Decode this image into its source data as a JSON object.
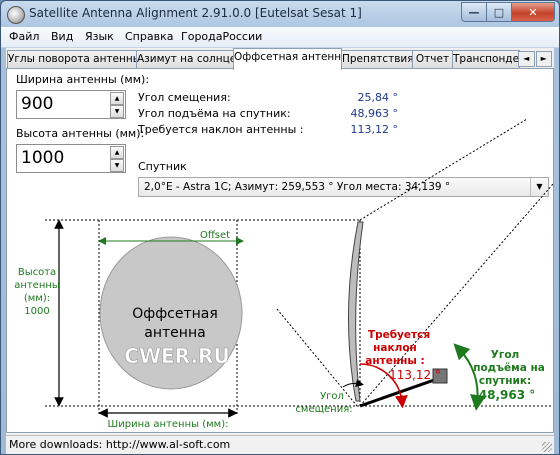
{
  "window": {
    "title": "Satellite Antenna Alignment 2.91.0.0 [Eutelsat Sesat 1]",
    "buttons": {
      "minimize": "—",
      "maximize": "□",
      "close": "✕"
    }
  },
  "menu": [
    "Файл",
    "Вид",
    "Язык",
    "Справка",
    "ГородаРоссии"
  ],
  "tabs": [
    "Углы поворота антенны",
    "Азимут на солнце",
    "Оффсетная антенна",
    "Препятствия",
    "Отчет",
    "Транспондеры"
  ],
  "active_tab_index": 2,
  "tab_scroll": {
    "left": "◄",
    "right": "►"
  },
  "form": {
    "width_label": "Ширина антенны (мм):",
    "width_value": "900",
    "height_label": "Высота антенны (мм):",
    "height_value": "1000",
    "spin_up": "▲",
    "spin_down": "▼"
  },
  "results": {
    "offset_angle_label": "Угол смещения:",
    "offset_angle_value": "25,84 °",
    "elevation_label": "Угол подъёма на спутник:",
    "elevation_value": "48,963 °",
    "tilt_label": "Требуется наклон антенны :",
    "tilt_value": "113,12 °"
  },
  "satellite": {
    "label": "Спутник",
    "selected": "2,0°E - Astra 1C;  Азимут: 259,553 °  Угол места: 34,139 °",
    "arrow": "▼"
  },
  "diagram": {
    "height_caption": [
      "Высота",
      "антенны",
      "(мм):",
      "1000"
    ],
    "offset_label": "Offset",
    "dish_title": [
      "Оффсетная",
      "антенна"
    ],
    "watermark": "CWER.RU",
    "width_caption": "Ширина антенны (мм):",
    "tilt_caption": [
      "Требуется",
      "наклон",
      "антенны :"
    ],
    "tilt_value": "113,12 °",
    "offset_caption": [
      "Угол",
      "смещения:"
    ],
    "elevation_caption": [
      "Угол",
      "подъёма на",
      "спутник:"
    ],
    "elevation_value": "48,963 °",
    "colors": {
      "green": "#1f7a1f",
      "red": "#cc0000",
      "ellipse": "#c8c8c8"
    }
  },
  "status": {
    "text": "More downloads: http://www.al-soft.com"
  }
}
